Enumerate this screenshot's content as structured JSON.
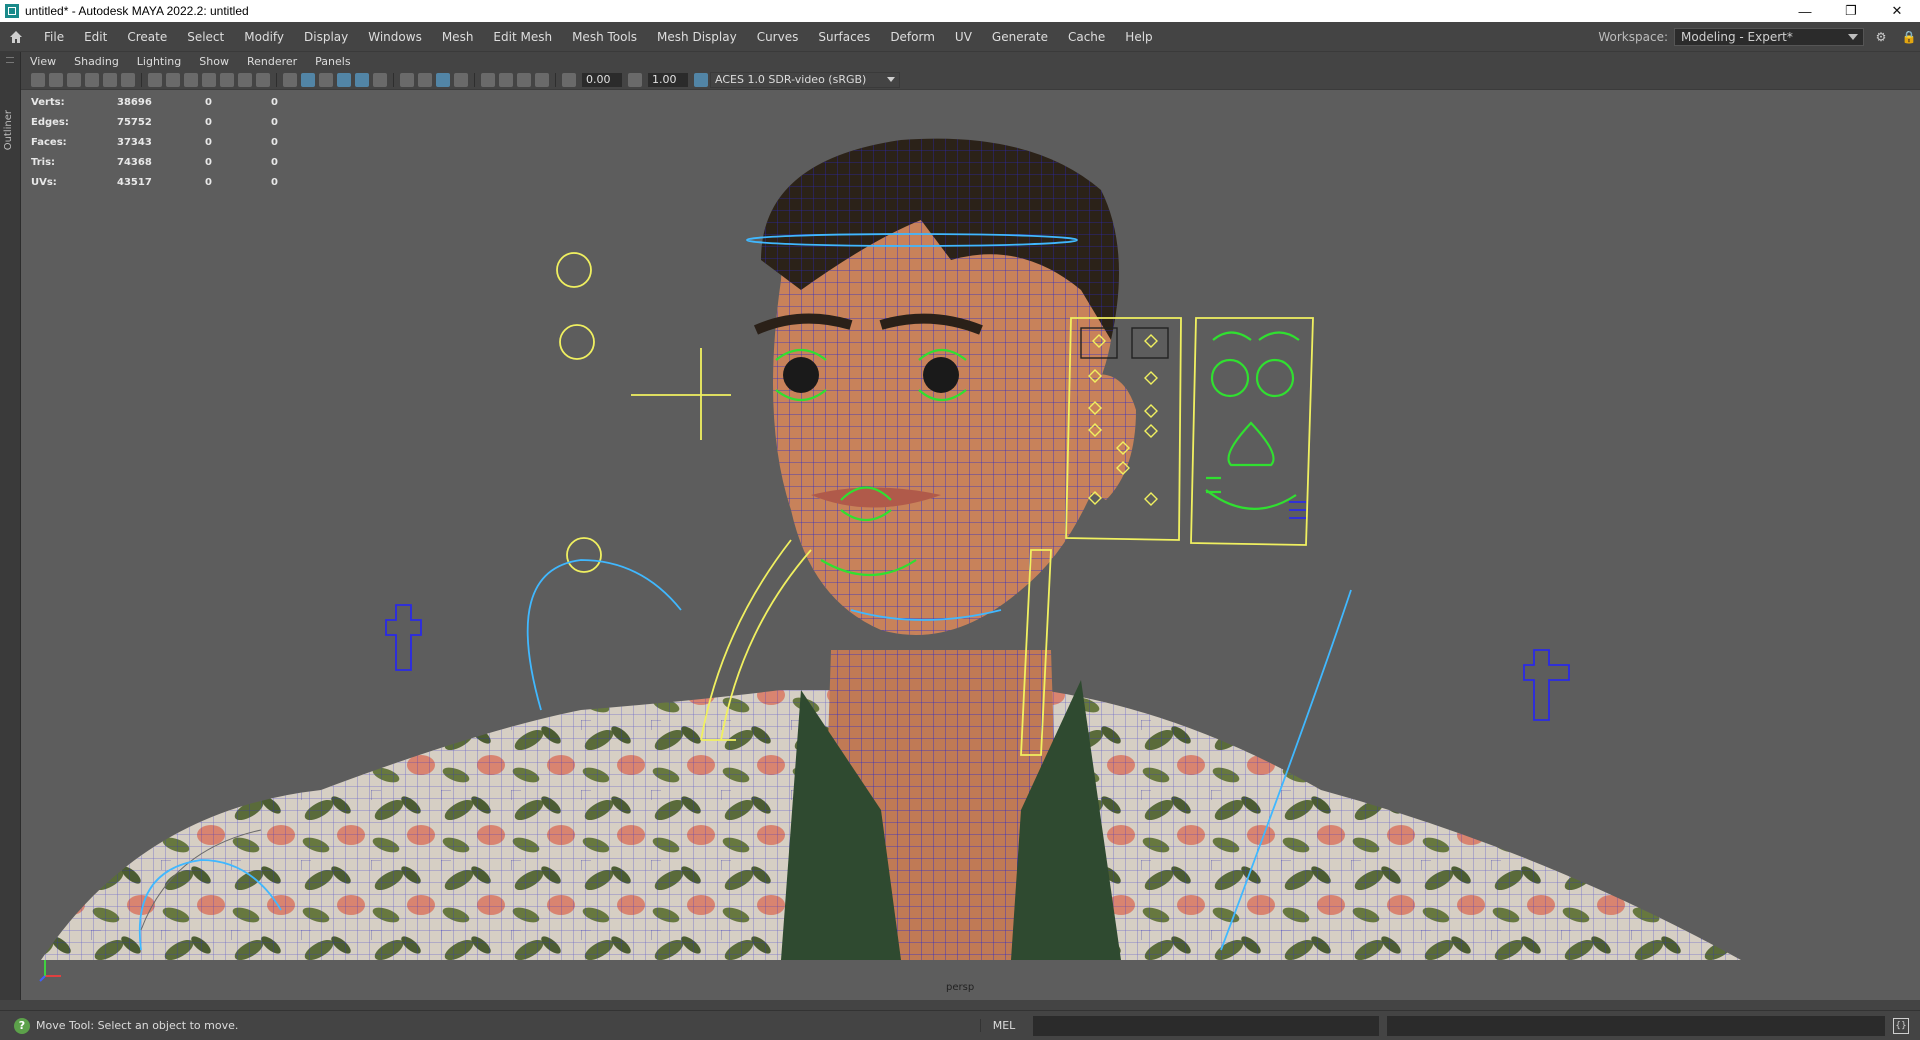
{
  "window": {
    "title": "untitled* - Autodesk MAYA 2022.2: untitled",
    "icon": "maya-icon"
  },
  "menubar": {
    "items": [
      "File",
      "Edit",
      "Create",
      "Select",
      "Modify",
      "Display",
      "Windows",
      "Mesh",
      "Edit Mesh",
      "Mesh Tools",
      "Mesh Display",
      "Curves",
      "Surfaces",
      "Deform",
      "UV",
      "Generate",
      "Cache",
      "Help"
    ],
    "workspace_label": "Workspace:",
    "workspace_value": "Modeling - Expert*"
  },
  "outliner": {
    "tab_label": "Outliner"
  },
  "panel": {
    "menu": [
      "View",
      "Shading",
      "Lighting",
      "Show",
      "Renderer",
      "Panels"
    ],
    "exposure": "0.00",
    "gamma": "1.00",
    "color_space": "ACES 1.0 SDR-video (sRGB)"
  },
  "stats": [
    {
      "label": "Verts:",
      "v1": "38696",
      "v2": "0",
      "v3": "0"
    },
    {
      "label": "Edges:",
      "v1": "75752",
      "v2": "0",
      "v3": "0"
    },
    {
      "label": "Faces:",
      "v1": "37343",
      "v2": "0",
      "v3": "0"
    },
    {
      "label": "Tris:",
      "v1": "74368",
      "v2": "0",
      "v3": "0"
    },
    {
      "label": "UVs:",
      "v1": "43517",
      "v2": "0",
      "v3": "0"
    }
  ],
  "viewport": {
    "camera": "persp"
  },
  "statusbar": {
    "help_text": "Move Tool: Select an object to move.",
    "command_language": "MEL"
  },
  "colors": {
    "viewport_bg": "#5d5d5d",
    "ui_bg": "#444444",
    "wire": "#2020c8",
    "ctrl_yellow": "#f0f060",
    "ctrl_green": "#30e030",
    "ctrl_cyan": "#40b8ff",
    "skin": "#c8825a"
  }
}
